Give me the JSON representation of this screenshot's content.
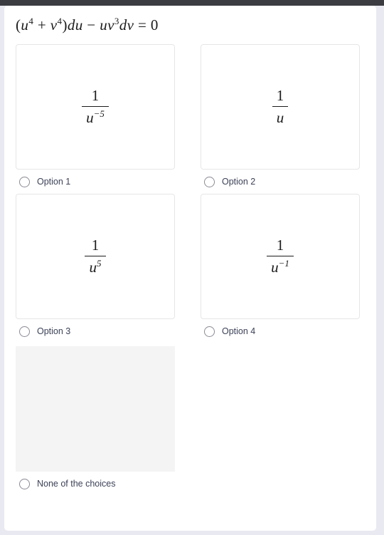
{
  "window": {
    "top_bar_color": "#3a3c41",
    "page_background": "#e9e9f2",
    "panel_background": "#ffffff"
  },
  "question": {
    "equation_plain": "(u^4 + v^4) du - u v^3 dv = 0",
    "equation_parts": {
      "open_paren": "(",
      "u": "u",
      "u_exp": "4",
      "plus": " + ",
      "v": "v",
      "v_exp": "4",
      "close_paren": ")",
      "du": "du",
      "minus": " − ",
      "uv": "uv",
      "v3_exp": "3",
      "dv": "dv",
      "equals": " = ",
      "zero": "0"
    }
  },
  "choices": [
    {
      "id": "option-1",
      "label": "Option 1",
      "content_type": "fraction",
      "numerator": "1",
      "denominator_base": "u",
      "denominator_exponent": "−5",
      "expression_plain": "1 / u^(-5)"
    },
    {
      "id": "option-2",
      "label": "Option 2",
      "content_type": "fraction",
      "numerator": "1",
      "denominator_base": "u",
      "denominator_exponent": "",
      "expression_plain": "1 / u"
    },
    {
      "id": "option-3",
      "label": "Option 3",
      "content_type": "fraction",
      "numerator": "1",
      "denominator_base": "u",
      "denominator_exponent": "5",
      "expression_plain": "1 / u^5"
    },
    {
      "id": "option-4",
      "label": "Option 4",
      "content_type": "fraction",
      "numerator": "1",
      "denominator_base": "u",
      "denominator_exponent": "−1",
      "expression_plain": "1 / u^(-1)"
    },
    {
      "id": "none-of-the-choices",
      "label": "None of the choices",
      "content_type": "empty-placeholder",
      "numerator": "",
      "denominator_base": "",
      "denominator_exponent": "",
      "expression_plain": "",
      "placeholder_color": "#f4f4f4"
    }
  ]
}
